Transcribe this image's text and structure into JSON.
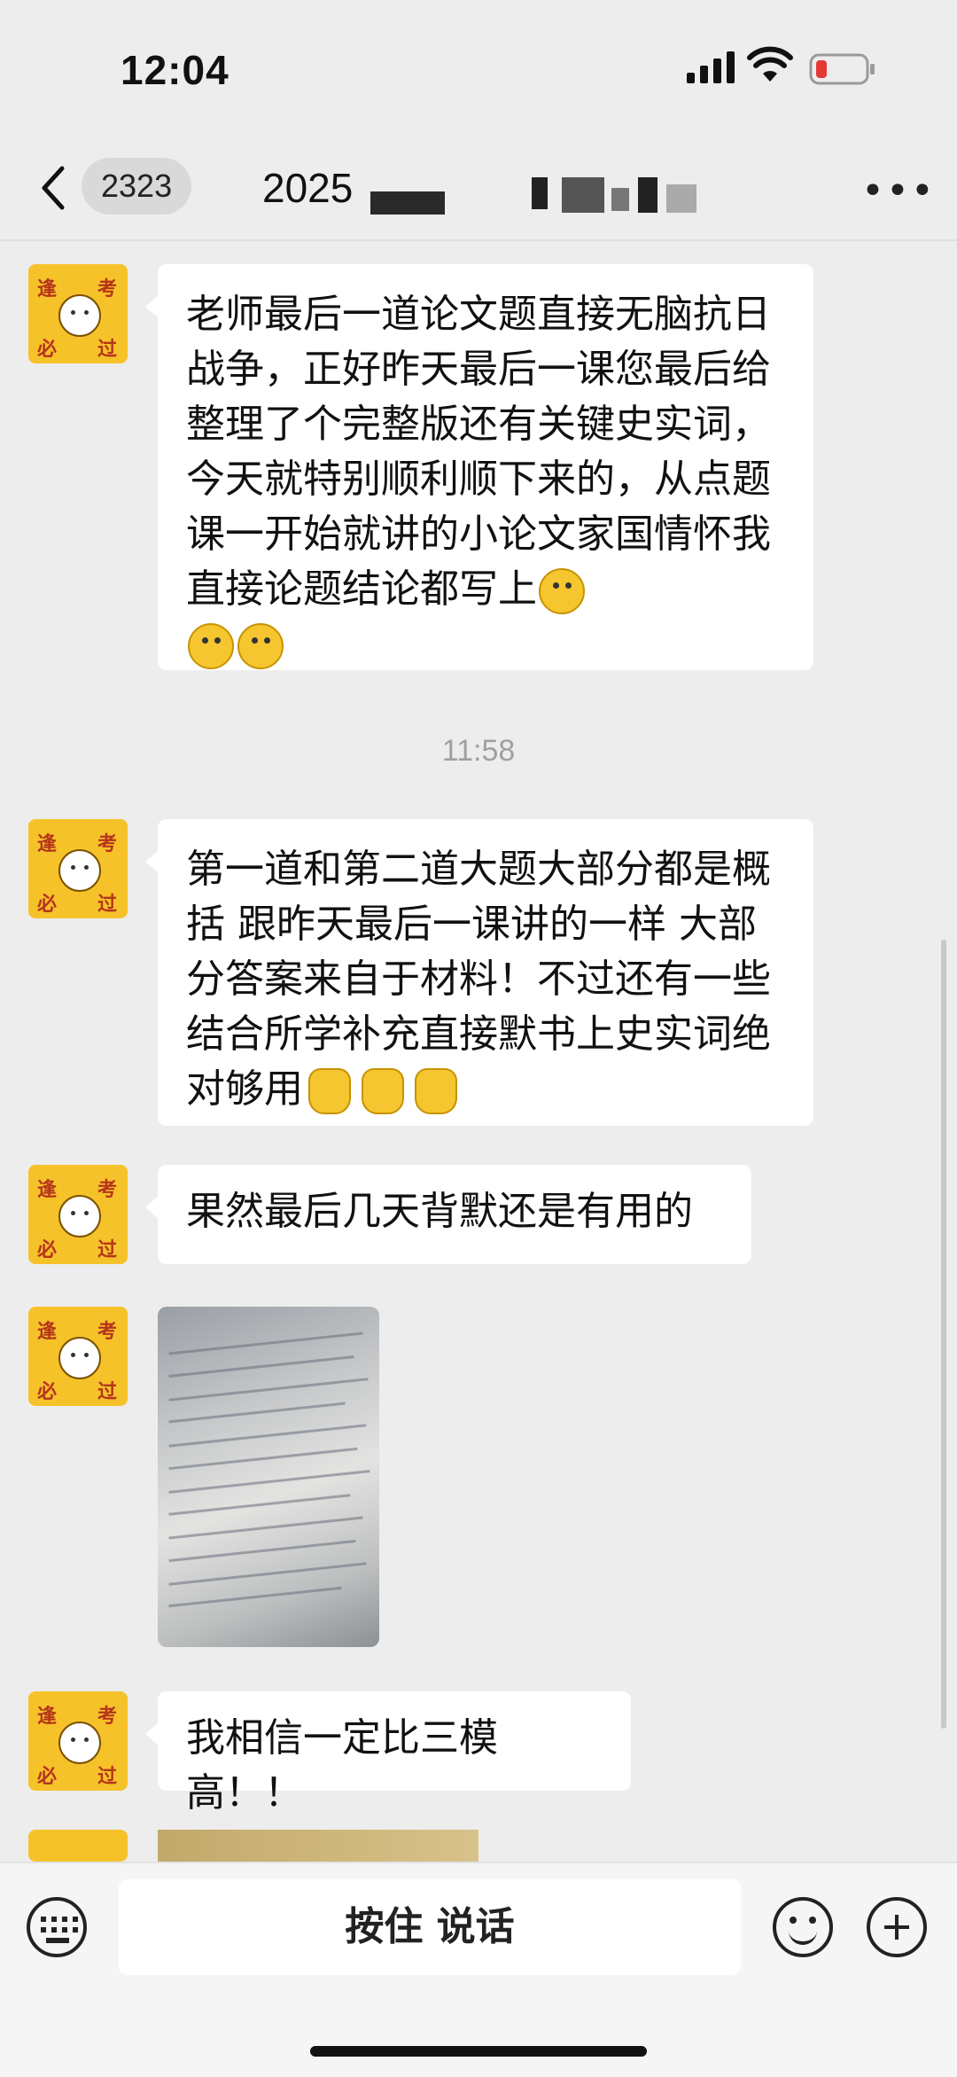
{
  "status": {
    "time": "12:04"
  },
  "nav": {
    "unread": "2323",
    "title": "2025"
  },
  "avatar": {
    "c1": "逢",
    "c2": "考",
    "c3": "必",
    "c4": "过"
  },
  "messages": [
    {
      "text": "老师最后一道论文题直接无脑抗日战争，正好昨天最后一课您最后给整理了个完整版还有关键史实词，今天就特别顺利顺下来的，从点题课一开始就讲的小论文家国情怀我直接论题结论都写上"
    },
    {
      "text": "第一道和第二道大题大部分都是概括 跟昨天最后一课讲的一样 大部分答案来自于材料！不过还有一些结合所学补充直接默书上史实词绝对够用"
    },
    {
      "text": "果然最后几天背默还是有用的"
    },
    {
      "text": "我相信一定比三模高！！"
    }
  ],
  "timestamp": "11:58",
  "input": {
    "talk_label": "按住 说话"
  },
  "icons": {
    "back": "chevron-left-icon",
    "more": "more-icon",
    "keyboard": "keyboard-icon",
    "emoji": "emoji-icon",
    "plus": "plus-icon"
  }
}
